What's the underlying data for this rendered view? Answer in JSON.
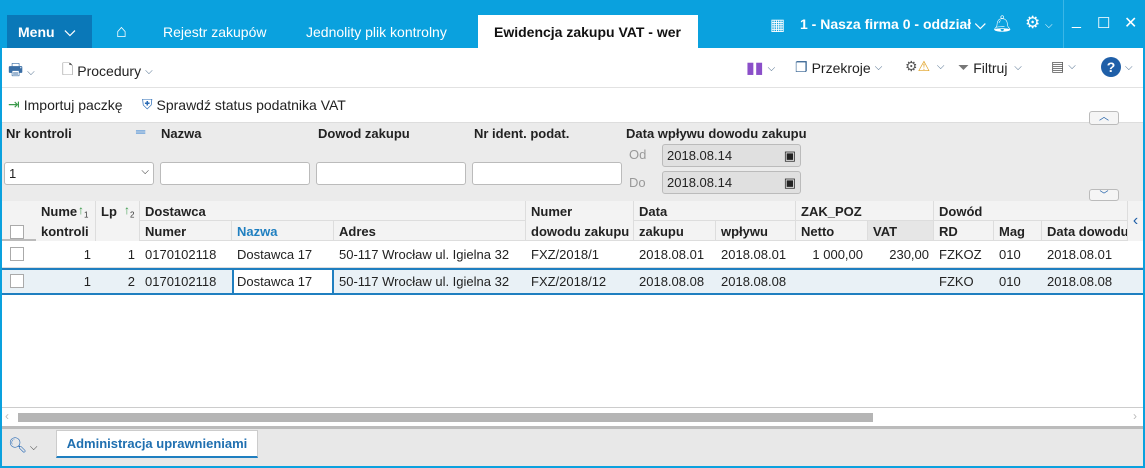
{
  "titlebar": {
    "menu": "Menu",
    "tabs": [
      "Rejestr zakupów",
      "Jednolity plik kontrolny",
      "Ewidencja zakupu VAT - wer"
    ],
    "company": "1 - Nasza firma 0 - oddział"
  },
  "toolbar": {
    "procedury": "Procedury",
    "przekroje": "Przekroje",
    "filtruj": "Filtruj"
  },
  "actions": {
    "import": "Importuj paczkę",
    "status": "Sprawdź status podatnika VAT"
  },
  "filters": {
    "nr_kontroli_label": "Nr kontroli",
    "nr_kontroli_value": "1",
    "nazwa_label": "Nazwa",
    "dowod_label": "Dowod zakupu",
    "nip_label": "Nr ident. podat.",
    "data_label": "Data wpływu dowodu zakupu",
    "od_label": "Od",
    "od_value": "2018.08.14",
    "do_label": "Do",
    "do_value": "2018.08.14"
  },
  "grid": {
    "group_headers": {
      "nume": "Nume",
      "lp": "Lp",
      "dostawca": "Dostawca",
      "numer": "Numer",
      "data": "Data",
      "zak_poz": "ZAK_POZ",
      "dowod": "Dowód",
      "sort1": "1",
      "sort2": "2"
    },
    "headers": {
      "kontroli": "kontroli",
      "numer": "Numer",
      "nazwa": "Nazwa",
      "adres": "Adres",
      "dowodu": "dowodu zakupu",
      "zakupu": "zakupu",
      "wplywu": "wpływu",
      "netto": "Netto",
      "vat": "VAT",
      "rd": "RD",
      "mag": "Mag",
      "data_dowodu": "Data dowodu"
    },
    "rows": [
      {
        "kontrola": "1",
        "lp": "1",
        "numer": "0170102118",
        "nazwa": "Dostawca 17",
        "adres": "50-117 Wrocław ul. Igielna 32",
        "dowod": "FXZ/2018/1",
        "zakupu": "2018.08.01",
        "wplywu": "2018.08.01",
        "netto": "1 000,00",
        "vat": "230,00",
        "rd": "FZKOZ",
        "mag": "010",
        "data_dowodu": "2018.08.01"
      },
      {
        "kontrola": "1",
        "lp": "2",
        "numer": "0170102118",
        "nazwa": "Dostawca 17",
        "adres": "50-117 Wrocław ul. Igielna 32",
        "dowod": "FXZ/2018/12",
        "zakupu": "2018.08.08",
        "wplywu": "2018.08.08",
        "netto": "",
        "vat": "",
        "rd": "FZKO",
        "mag": "010",
        "data_dowodu": "2018.08.08"
      }
    ]
  },
  "bottom": {
    "admin": "Administracja uprawnieniami"
  }
}
